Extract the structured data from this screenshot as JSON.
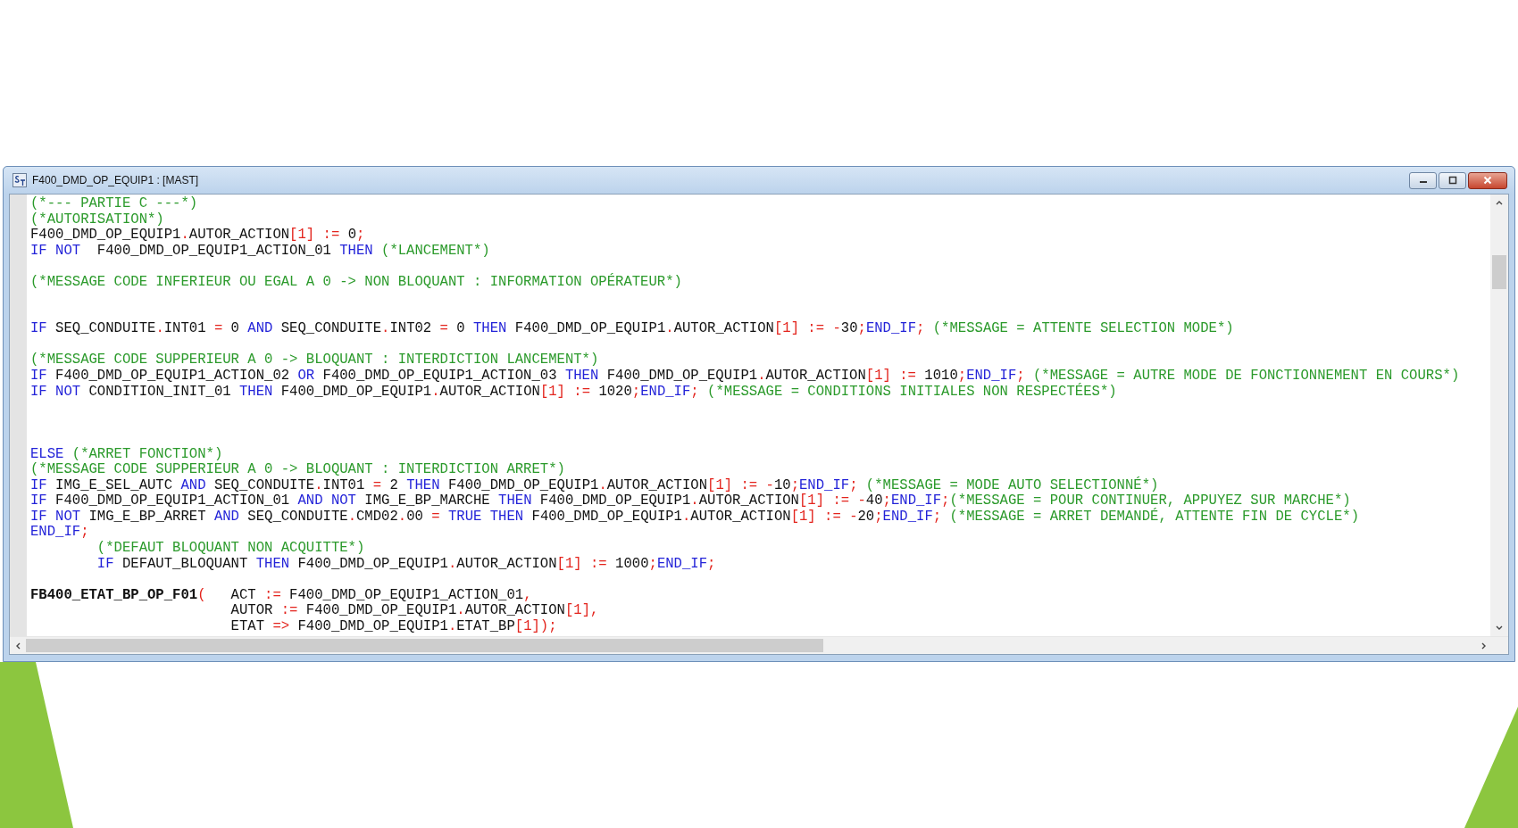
{
  "window": {
    "title": "F400_DMD_OP_EQUIP1 : [MAST]"
  },
  "editor": {
    "lines": [
      {
        "kind": "code",
        "tokens": [
          {
            "kind": "comment",
            "text": "(*--- PARTIE C ---*)"
          }
        ]
      },
      {
        "kind": "code",
        "tokens": [
          {
            "kind": "comment",
            "text": "(*AUTORISATION*)"
          }
        ]
      },
      {
        "kind": "code",
        "tokens": [
          {
            "kind": "plain",
            "text": "F400_DMD_OP_EQUIP1"
          },
          {
            "kind": "operator",
            "text": "."
          },
          {
            "kind": "plain",
            "text": "AUTOR_ACTION"
          },
          {
            "kind": "operator",
            "text": "[1] := "
          },
          {
            "kind": "plain",
            "text": "0"
          },
          {
            "kind": "operator",
            "text": ";"
          }
        ]
      },
      {
        "kind": "code",
        "tokens": [
          {
            "kind": "keyword",
            "text": "IF NOT"
          },
          {
            "kind": "plain",
            "text": "  F400_DMD_OP_EQUIP1_ACTION_01 "
          },
          {
            "kind": "keyword",
            "text": "THEN"
          },
          {
            "kind": "comment",
            "text": " (*LANCEMENT*)"
          }
        ]
      },
      {
        "kind": "blank"
      },
      {
        "kind": "code",
        "tokens": [
          {
            "kind": "comment",
            "text": "(*MESSAGE CODE INFERIEUR OU EGAL A 0 -> NON BLOQUANT : INFORMATION OPÉRATEUR*)"
          }
        ]
      },
      {
        "kind": "blank"
      },
      {
        "kind": "blank"
      },
      {
        "kind": "code",
        "tokens": [
          {
            "kind": "keyword",
            "text": "IF"
          },
          {
            "kind": "plain",
            "text": " SEQ_CONDUITE"
          },
          {
            "kind": "operator",
            "text": "."
          },
          {
            "kind": "plain",
            "text": "INT01 "
          },
          {
            "kind": "operator",
            "text": "="
          },
          {
            "kind": "plain",
            "text": " 0 "
          },
          {
            "kind": "keyword",
            "text": "AND"
          },
          {
            "kind": "plain",
            "text": " SEQ_CONDUITE"
          },
          {
            "kind": "operator",
            "text": "."
          },
          {
            "kind": "plain",
            "text": "INT02 "
          },
          {
            "kind": "operator",
            "text": "="
          },
          {
            "kind": "plain",
            "text": " 0 "
          },
          {
            "kind": "keyword",
            "text": "THEN"
          },
          {
            "kind": "plain",
            "text": " F400_DMD_OP_EQUIP1"
          },
          {
            "kind": "operator",
            "text": "."
          },
          {
            "kind": "plain",
            "text": "AUTOR_ACTION"
          },
          {
            "kind": "operator",
            "text": "[1] := -"
          },
          {
            "kind": "plain",
            "text": "30"
          },
          {
            "kind": "operator",
            "text": ";"
          },
          {
            "kind": "keyword",
            "text": "END_IF"
          },
          {
            "kind": "operator",
            "text": ";"
          },
          {
            "kind": "comment",
            "text": " (*MESSAGE = ATTENTE SELECTION MODE*)"
          }
        ]
      },
      {
        "kind": "blank"
      },
      {
        "kind": "code",
        "tokens": [
          {
            "kind": "comment",
            "text": "(*MESSAGE CODE SUPPERIEUR A 0 -> BLOQUANT : INTERDICTION LANCEMENT*)"
          }
        ]
      },
      {
        "kind": "code",
        "tokens": [
          {
            "kind": "keyword",
            "text": "IF"
          },
          {
            "kind": "plain",
            "text": " F400_DMD_OP_EQUIP1_ACTION_02 "
          },
          {
            "kind": "keyword",
            "text": "OR"
          },
          {
            "kind": "plain",
            "text": " F400_DMD_OP_EQUIP1_ACTION_03 "
          },
          {
            "kind": "keyword",
            "text": "THEN"
          },
          {
            "kind": "plain",
            "text": " F400_DMD_OP_EQUIP1"
          },
          {
            "kind": "operator",
            "text": "."
          },
          {
            "kind": "plain",
            "text": "AUTOR_ACTION"
          },
          {
            "kind": "operator",
            "text": "[1] := "
          },
          {
            "kind": "plain",
            "text": "1010"
          },
          {
            "kind": "operator",
            "text": ";"
          },
          {
            "kind": "keyword",
            "text": "END_IF"
          },
          {
            "kind": "operator",
            "text": ";"
          },
          {
            "kind": "comment",
            "text": " (*MESSAGE = AUTRE MODE DE FONCTIONNEMENT EN COURS*)"
          }
        ]
      },
      {
        "kind": "code",
        "tokens": [
          {
            "kind": "keyword",
            "text": "IF NOT"
          },
          {
            "kind": "plain",
            "text": " CONDITION_INIT_01 "
          },
          {
            "kind": "keyword",
            "text": "THEN"
          },
          {
            "kind": "plain",
            "text": " F400_DMD_OP_EQUIP1"
          },
          {
            "kind": "operator",
            "text": "."
          },
          {
            "kind": "plain",
            "text": "AUTOR_ACTION"
          },
          {
            "kind": "operator",
            "text": "[1] := "
          },
          {
            "kind": "plain",
            "text": "1020"
          },
          {
            "kind": "operator",
            "text": ";"
          },
          {
            "kind": "keyword",
            "text": "END_IF"
          },
          {
            "kind": "operator",
            "text": ";"
          },
          {
            "kind": "comment",
            "text": " (*MESSAGE = CONDITIONS INITIALES NON RESPECTÉES*)"
          }
        ]
      },
      {
        "kind": "blank"
      },
      {
        "kind": "blank"
      },
      {
        "kind": "blank"
      },
      {
        "kind": "code",
        "tokens": [
          {
            "kind": "keyword",
            "text": "ELSE"
          },
          {
            "kind": "comment",
            "text": " (*ARRET FONCTION*)"
          }
        ]
      },
      {
        "kind": "code",
        "tokens": [
          {
            "kind": "comment",
            "text": "(*MESSAGE CODE SUPPERIEUR A 0 -> BLOQUANT : INTERDICTION ARRET*)"
          }
        ]
      },
      {
        "kind": "code",
        "tokens": [
          {
            "kind": "keyword",
            "text": "IF"
          },
          {
            "kind": "plain",
            "text": " IMG_E_SEL_AUTC "
          },
          {
            "kind": "keyword",
            "text": "AND"
          },
          {
            "kind": "plain",
            "text": " SEQ_CONDUITE"
          },
          {
            "kind": "operator",
            "text": "."
          },
          {
            "kind": "plain",
            "text": "INT01 "
          },
          {
            "kind": "operator",
            "text": "="
          },
          {
            "kind": "plain",
            "text": " 2 "
          },
          {
            "kind": "keyword",
            "text": "THEN"
          },
          {
            "kind": "plain",
            "text": " F400_DMD_OP_EQUIP1"
          },
          {
            "kind": "operator",
            "text": "."
          },
          {
            "kind": "plain",
            "text": "AUTOR_ACTION"
          },
          {
            "kind": "operator",
            "text": "[1] := -"
          },
          {
            "kind": "plain",
            "text": "10"
          },
          {
            "kind": "operator",
            "text": ";"
          },
          {
            "kind": "keyword",
            "text": "END_IF"
          },
          {
            "kind": "operator",
            "text": ";"
          },
          {
            "kind": "comment",
            "text": " (*MESSAGE = MODE AUTO SELECTIONNÉ*)"
          }
        ]
      },
      {
        "kind": "code",
        "tokens": [
          {
            "kind": "keyword",
            "text": "IF"
          },
          {
            "kind": "plain",
            "text": " F400_DMD_OP_EQUIP1_ACTION_01 "
          },
          {
            "kind": "keyword",
            "text": "AND NOT"
          },
          {
            "kind": "plain",
            "text": " IMG_E_BP_MARCHE "
          },
          {
            "kind": "keyword",
            "text": "THEN"
          },
          {
            "kind": "plain",
            "text": " F400_DMD_OP_EQUIP1"
          },
          {
            "kind": "operator",
            "text": "."
          },
          {
            "kind": "plain",
            "text": "AUTOR_ACTION"
          },
          {
            "kind": "operator",
            "text": "[1] := -"
          },
          {
            "kind": "plain",
            "text": "40"
          },
          {
            "kind": "operator",
            "text": ";"
          },
          {
            "kind": "keyword",
            "text": "END_IF"
          },
          {
            "kind": "operator",
            "text": ";"
          },
          {
            "kind": "comment",
            "text": "(*MESSAGE = POUR CONTINUER, APPUYEZ SUR MARCHE*)"
          }
        ]
      },
      {
        "kind": "code",
        "tokens": [
          {
            "kind": "keyword",
            "text": "IF NOT"
          },
          {
            "kind": "plain",
            "text": " IMG_E_BP_ARRET "
          },
          {
            "kind": "keyword",
            "text": "AND"
          },
          {
            "kind": "plain",
            "text": " SEQ_CONDUITE"
          },
          {
            "kind": "operator",
            "text": "."
          },
          {
            "kind": "plain",
            "text": "CMD02"
          },
          {
            "kind": "operator",
            "text": "."
          },
          {
            "kind": "plain",
            "text": "00 "
          },
          {
            "kind": "operator",
            "text": "= "
          },
          {
            "kind": "keyword",
            "text": "TRUE THEN"
          },
          {
            "kind": "plain",
            "text": " F400_DMD_OP_EQUIP1"
          },
          {
            "kind": "operator",
            "text": "."
          },
          {
            "kind": "plain",
            "text": "AUTOR_ACTION"
          },
          {
            "kind": "operator",
            "text": "[1] := -"
          },
          {
            "kind": "plain",
            "text": "20"
          },
          {
            "kind": "operator",
            "text": ";"
          },
          {
            "kind": "keyword",
            "text": "END_IF"
          },
          {
            "kind": "operator",
            "text": ";"
          },
          {
            "kind": "comment",
            "text": " (*MESSAGE = ARRET DEMANDÉ, ATTENTE FIN DE CYCLE*)"
          }
        ]
      },
      {
        "kind": "code",
        "tokens": [
          {
            "kind": "keyword",
            "text": "END_IF"
          },
          {
            "kind": "operator",
            "text": ";"
          }
        ]
      },
      {
        "kind": "nested",
        "tokens": [
          {
            "kind": "comment",
            "text": "(*DEFAUT BLOQUANT NON ACQUITTE*)"
          }
        ]
      },
      {
        "kind": "nested",
        "tokens": [
          {
            "kind": "keyword",
            "text": "IF"
          },
          {
            "kind": "plain",
            "text": " DEFAUT_BLOQUANT "
          },
          {
            "kind": "keyword",
            "text": "THEN"
          },
          {
            "kind": "plain",
            "text": " F400_DMD_OP_EQUIP1"
          },
          {
            "kind": "operator",
            "text": "."
          },
          {
            "kind": "plain",
            "text": "AUTOR_ACTION"
          },
          {
            "kind": "operator",
            "text": "[1] := "
          },
          {
            "kind": "plain",
            "text": "1000"
          },
          {
            "kind": "operator",
            "text": ";"
          },
          {
            "kind": "keyword",
            "text": "END_IF"
          },
          {
            "kind": "operator",
            "text": ";"
          }
        ]
      },
      {
        "kind": "blank"
      },
      {
        "kind": "code",
        "tokens": [
          {
            "kind": "bold",
            "text": "FB400_ETAT_BP_OP_F01"
          },
          {
            "kind": "operator",
            "text": "("
          },
          {
            "kind": "plain",
            "text": "   ACT "
          },
          {
            "kind": "operator",
            "text": ":="
          },
          {
            "kind": "plain",
            "text": " F400_DMD_OP_EQUIP1_ACTION_01"
          },
          {
            "kind": "operator",
            "text": ","
          }
        ]
      },
      {
        "kind": "argument",
        "tokens": [
          {
            "kind": "plain",
            "text": "AUTOR "
          },
          {
            "kind": "operator",
            "text": ":="
          },
          {
            "kind": "plain",
            "text": " F400_DMD_OP_EQUIP1"
          },
          {
            "kind": "operator",
            "text": "."
          },
          {
            "kind": "plain",
            "text": "AUTOR_ACTION"
          },
          {
            "kind": "operator",
            "text": "[1],"
          }
        ]
      },
      {
        "kind": "argument",
        "tokens": [
          {
            "kind": "plain",
            "text": "ETAT "
          },
          {
            "kind": "operator",
            "text": "=>"
          },
          {
            "kind": "plain",
            "text": " F400_DMD_OP_EQUIP1"
          },
          {
            "kind": "operator",
            "text": "."
          },
          {
            "kind": "plain",
            "text": "ETAT_BP"
          },
          {
            "kind": "operator",
            "text": "[1]);"
          }
        ]
      }
    ]
  }
}
